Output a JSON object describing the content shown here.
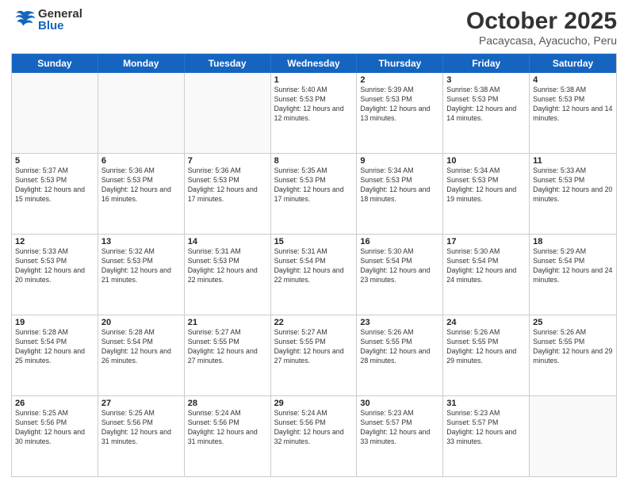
{
  "header": {
    "logo_general": "General",
    "logo_blue": "Blue",
    "month_title": "October 2025",
    "location": "Pacaycasa, Ayacucho, Peru"
  },
  "days_of_week": [
    "Sunday",
    "Monday",
    "Tuesday",
    "Wednesday",
    "Thursday",
    "Friday",
    "Saturday"
  ],
  "weeks": [
    [
      {
        "day": "",
        "text": ""
      },
      {
        "day": "",
        "text": ""
      },
      {
        "day": "",
        "text": ""
      },
      {
        "day": "1",
        "text": "Sunrise: 5:40 AM\nSunset: 5:53 PM\nDaylight: 12 hours and 12 minutes."
      },
      {
        "day": "2",
        "text": "Sunrise: 5:39 AM\nSunset: 5:53 PM\nDaylight: 12 hours and 13 minutes."
      },
      {
        "day": "3",
        "text": "Sunrise: 5:38 AM\nSunset: 5:53 PM\nDaylight: 12 hours and 14 minutes."
      },
      {
        "day": "4",
        "text": "Sunrise: 5:38 AM\nSunset: 5:53 PM\nDaylight: 12 hours and 14 minutes."
      }
    ],
    [
      {
        "day": "5",
        "text": "Sunrise: 5:37 AM\nSunset: 5:53 PM\nDaylight: 12 hours and 15 minutes."
      },
      {
        "day": "6",
        "text": "Sunrise: 5:36 AM\nSunset: 5:53 PM\nDaylight: 12 hours and 16 minutes."
      },
      {
        "day": "7",
        "text": "Sunrise: 5:36 AM\nSunset: 5:53 PM\nDaylight: 12 hours and 17 minutes."
      },
      {
        "day": "8",
        "text": "Sunrise: 5:35 AM\nSunset: 5:53 PM\nDaylight: 12 hours and 17 minutes."
      },
      {
        "day": "9",
        "text": "Sunrise: 5:34 AM\nSunset: 5:53 PM\nDaylight: 12 hours and 18 minutes."
      },
      {
        "day": "10",
        "text": "Sunrise: 5:34 AM\nSunset: 5:53 PM\nDaylight: 12 hours and 19 minutes."
      },
      {
        "day": "11",
        "text": "Sunrise: 5:33 AM\nSunset: 5:53 PM\nDaylight: 12 hours and 20 minutes."
      }
    ],
    [
      {
        "day": "12",
        "text": "Sunrise: 5:33 AM\nSunset: 5:53 PM\nDaylight: 12 hours and 20 minutes."
      },
      {
        "day": "13",
        "text": "Sunrise: 5:32 AM\nSunset: 5:53 PM\nDaylight: 12 hours and 21 minutes."
      },
      {
        "day": "14",
        "text": "Sunrise: 5:31 AM\nSunset: 5:53 PM\nDaylight: 12 hours and 22 minutes."
      },
      {
        "day": "15",
        "text": "Sunrise: 5:31 AM\nSunset: 5:54 PM\nDaylight: 12 hours and 22 minutes."
      },
      {
        "day": "16",
        "text": "Sunrise: 5:30 AM\nSunset: 5:54 PM\nDaylight: 12 hours and 23 minutes."
      },
      {
        "day": "17",
        "text": "Sunrise: 5:30 AM\nSunset: 5:54 PM\nDaylight: 12 hours and 24 minutes."
      },
      {
        "day": "18",
        "text": "Sunrise: 5:29 AM\nSunset: 5:54 PM\nDaylight: 12 hours and 24 minutes."
      }
    ],
    [
      {
        "day": "19",
        "text": "Sunrise: 5:28 AM\nSunset: 5:54 PM\nDaylight: 12 hours and 25 minutes."
      },
      {
        "day": "20",
        "text": "Sunrise: 5:28 AM\nSunset: 5:54 PM\nDaylight: 12 hours and 26 minutes."
      },
      {
        "day": "21",
        "text": "Sunrise: 5:27 AM\nSunset: 5:55 PM\nDaylight: 12 hours and 27 minutes."
      },
      {
        "day": "22",
        "text": "Sunrise: 5:27 AM\nSunset: 5:55 PM\nDaylight: 12 hours and 27 minutes."
      },
      {
        "day": "23",
        "text": "Sunrise: 5:26 AM\nSunset: 5:55 PM\nDaylight: 12 hours and 28 minutes."
      },
      {
        "day": "24",
        "text": "Sunrise: 5:26 AM\nSunset: 5:55 PM\nDaylight: 12 hours and 29 minutes."
      },
      {
        "day": "25",
        "text": "Sunrise: 5:26 AM\nSunset: 5:55 PM\nDaylight: 12 hours and 29 minutes."
      }
    ],
    [
      {
        "day": "26",
        "text": "Sunrise: 5:25 AM\nSunset: 5:56 PM\nDaylight: 12 hours and 30 minutes."
      },
      {
        "day": "27",
        "text": "Sunrise: 5:25 AM\nSunset: 5:56 PM\nDaylight: 12 hours and 31 minutes."
      },
      {
        "day": "28",
        "text": "Sunrise: 5:24 AM\nSunset: 5:56 PM\nDaylight: 12 hours and 31 minutes."
      },
      {
        "day": "29",
        "text": "Sunrise: 5:24 AM\nSunset: 5:56 PM\nDaylight: 12 hours and 32 minutes."
      },
      {
        "day": "30",
        "text": "Sunrise: 5:23 AM\nSunset: 5:57 PM\nDaylight: 12 hours and 33 minutes."
      },
      {
        "day": "31",
        "text": "Sunrise: 5:23 AM\nSunset: 5:57 PM\nDaylight: 12 hours and 33 minutes."
      },
      {
        "day": "",
        "text": ""
      }
    ]
  ]
}
